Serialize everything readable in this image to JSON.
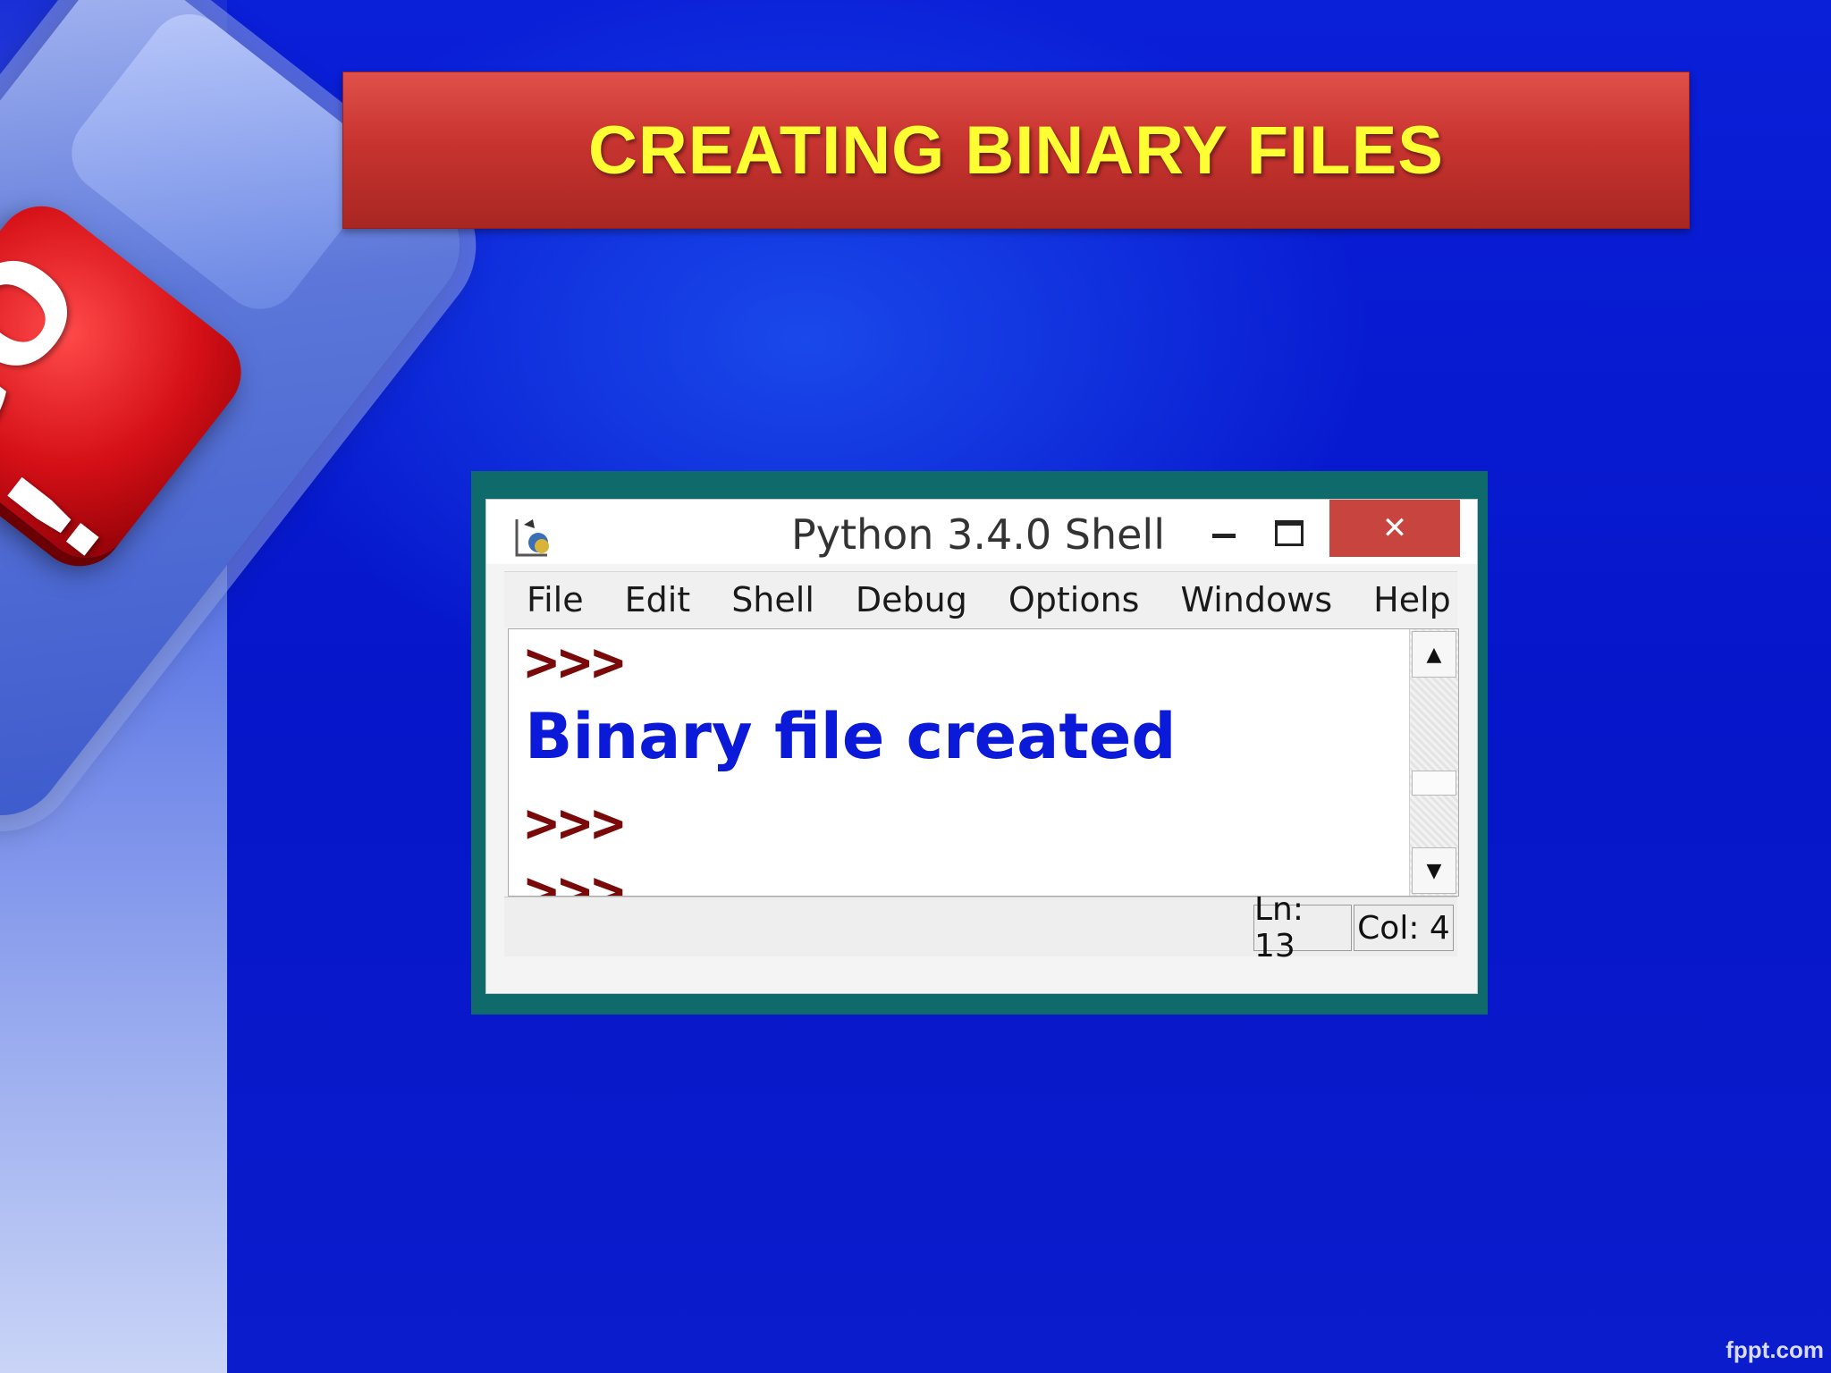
{
  "slide": {
    "title": "CREATING BINARY FILES",
    "decoration_key_label": "GO !",
    "watermark": "fppt.com"
  },
  "window": {
    "title": "Python 3.4.0 Shell",
    "icon": "python-idle-icon",
    "controls": {
      "minimize_icon": "minimize-icon",
      "maximize_icon": "maximize-icon",
      "close_label": "✕"
    }
  },
  "menubar": {
    "items": [
      "File",
      "Edit",
      "Shell",
      "Debug",
      "Options",
      "Windows",
      "Help"
    ]
  },
  "editor": {
    "lines": [
      {
        "type": "prompt",
        "text": ">>>"
      },
      {
        "type": "output",
        "text": "Binary file created"
      },
      {
        "type": "prompt",
        "text": ">>>"
      },
      {
        "type": "prompt",
        "text": ">>>"
      }
    ]
  },
  "scrollbar": {
    "up_icon": "▲",
    "down_icon": "▼"
  },
  "statusbar": {
    "line": "Ln: 13",
    "col": "Col: 4"
  },
  "colors": {
    "background": "#0616c9",
    "title_banner": "#c83430",
    "title_text": "#ffff33",
    "frame": "#0f6b6b",
    "close_button": "#c7443f",
    "prompt": "#7a0a0a",
    "output": "#0a1ad8"
  }
}
